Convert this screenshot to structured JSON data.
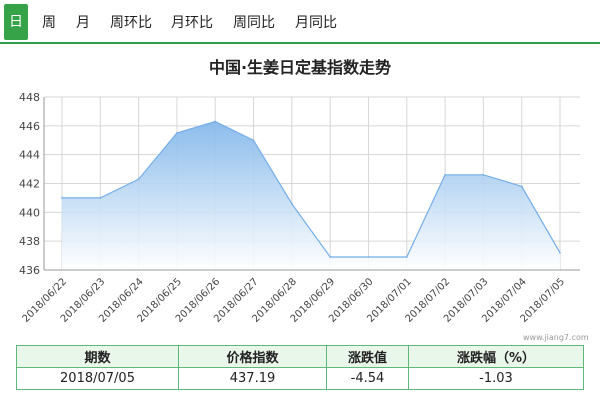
{
  "tabs": [
    {
      "label": "日",
      "active": true
    },
    {
      "label": "周",
      "active": false
    },
    {
      "label": "月",
      "active": false
    },
    {
      "label": "周环比",
      "active": false
    },
    {
      "label": "月环比",
      "active": false
    },
    {
      "label": "周同比",
      "active": false
    },
    {
      "label": "月同比",
      "active": false
    }
  ],
  "watermark": "www.jiang7.com",
  "chart_data": {
    "type": "area",
    "title": "中国·生姜日定基指数走势",
    "xlabel": "",
    "ylabel": "",
    "ylim": [
      436,
      448
    ],
    "yticks": [
      436,
      438,
      440,
      442,
      444,
      446,
      448
    ],
    "categories": [
      "2018/06/22",
      "2018/06/23",
      "2018/06/24",
      "2018/06/25",
      "2018/06/26",
      "2018/06/27",
      "2018/06/28",
      "2018/06/29",
      "2018/06/30",
      "2018/07/01",
      "2018/07/02",
      "2018/07/03",
      "2018/07/04",
      "2018/07/05"
    ],
    "values": [
      441.0,
      441.0,
      442.3,
      445.5,
      446.3,
      445.0,
      440.6,
      436.9,
      436.9,
      436.9,
      442.6,
      442.6,
      441.8,
      437.19
    ],
    "grid": true,
    "colors": {
      "line": "#74ade8",
      "fill_top": "#7fb5ea",
      "fill_bottom": "#ffffff",
      "grid": "#d6d6d6"
    }
  },
  "table": {
    "headers": [
      "期数",
      "价格指数",
      "涨跌值",
      "涨跌幅（%）"
    ],
    "rows": [
      [
        "2018/07/05",
        "437.19",
        "-4.54",
        "-1.03"
      ]
    ]
  },
  "colors": {
    "accent": "#36a349",
    "border": "#5fb87a",
    "header_bg": "#e9f6ea"
  }
}
